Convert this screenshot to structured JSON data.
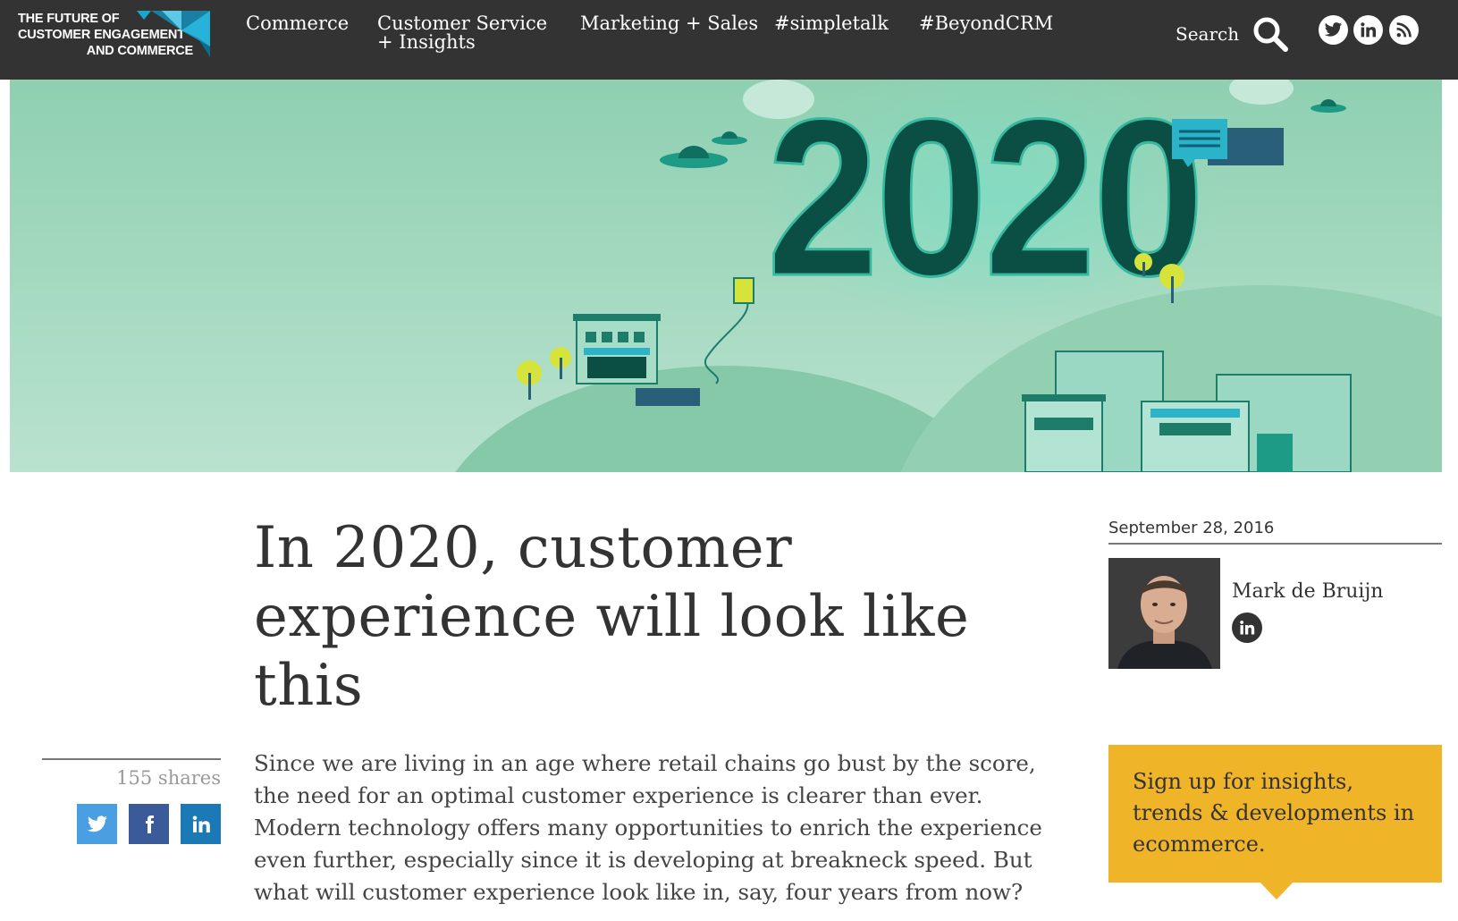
{
  "brand": {
    "logo_line1": "THE FUTURE OF",
    "logo_line2": "CUSTOMER ENGAGEMENT",
    "logo_line3": "AND COMMERCE",
    "dark_bg": "#333333",
    "accent_blue": "#1aa6cf",
    "accent_yellow": "#f0b428"
  },
  "nav": {
    "commerce": "Commerce",
    "customer_service_line1": "Customer Service",
    "customer_service_line2": "+ Insights",
    "marketing_sales": "Marketing + Sales",
    "simpletalk": "#simpletalk",
    "beyond_crm": "#BeyondCRM",
    "search_label": "Search",
    "social_icons": [
      "twitter-icon",
      "linkedin-icon",
      "rss-icon"
    ]
  },
  "hero": {
    "year_text": "2020"
  },
  "article": {
    "title": "In 2020, customer experience will look like this",
    "lede": "Since we are living in an age where retail chains go bust by the score, the need for an optimal customer experience is clearer than ever. Modern technology offers many opportunities to enrich the experience even further, especially since it is developing at breakneck speed. But what will customer experience look like in, say, four years from now?"
  },
  "share": {
    "count_text": "155 shares",
    "buttons": [
      "twitter-icon",
      "facebook-icon",
      "linkedin-icon"
    ]
  },
  "sidebar": {
    "date": "September 28, 2016",
    "author_name": "Mark de Bruijn",
    "signup_text": "Sign up for insights, trends & developments in ecommerce."
  }
}
